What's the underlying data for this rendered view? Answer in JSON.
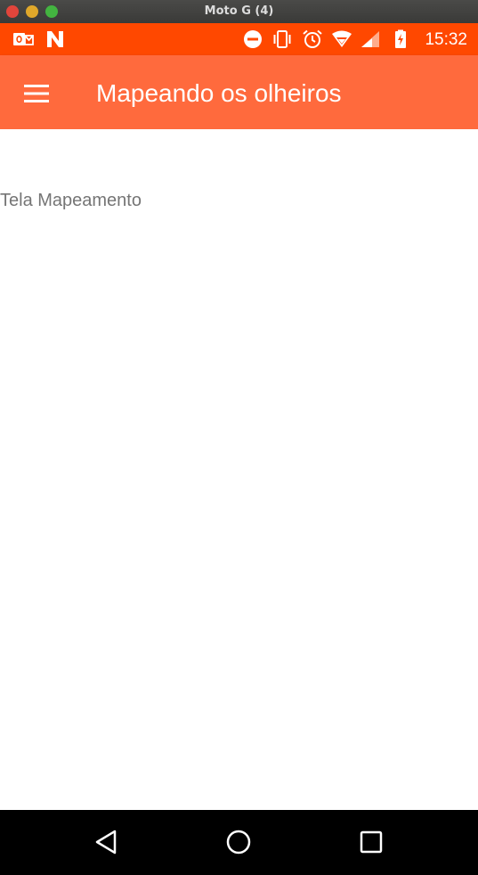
{
  "window": {
    "title": "Moto G (4)"
  },
  "status_bar": {
    "time": "15:32",
    "left_icons": [
      "outlook-icon",
      "n-notification-icon"
    ],
    "right_icons": [
      "do-not-disturb-icon",
      "vibrate-icon",
      "alarm-icon",
      "wifi-icon",
      "signal-icon",
      "battery-charging-icon"
    ],
    "color": "#ff4800"
  },
  "app_bar": {
    "title": "Mapeando os olheiros",
    "menu_icon": "hamburger-menu-icon",
    "color": "#ff6a3d"
  },
  "content": {
    "label": "Tela Mapeamento"
  },
  "nav_bar": {
    "buttons": [
      "back-icon",
      "home-icon",
      "recents-icon"
    ]
  }
}
